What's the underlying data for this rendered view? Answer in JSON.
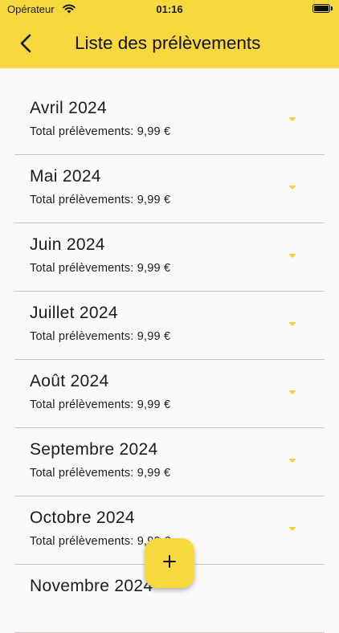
{
  "status_bar": {
    "carrier": "Opérateur",
    "time": "01:16"
  },
  "header": {
    "title": "Liste des prélèvements"
  },
  "months": [
    {
      "label": "Avril 2024",
      "total": "Total prélèvements: 9,99 €"
    },
    {
      "label": "Mai 2024",
      "total": "Total prélèvements: 9,99 €"
    },
    {
      "label": "Juin 2024",
      "total": "Total prélèvements: 9,99 €"
    },
    {
      "label": "Juillet 2024",
      "total": "Total prélèvements: 9,99 €"
    },
    {
      "label": "Août 2024",
      "total": "Total prélèvements: 9,99 €"
    },
    {
      "label": "Septembre 2024",
      "total": "Total prélèvements: 9,99 €"
    },
    {
      "label": "Octobre 2024",
      "total": "Total prélèvements: 9,99 €"
    },
    {
      "label": "Novembre 2024",
      "total": ""
    }
  ],
  "icons": {
    "back": "chevron-left-icon",
    "expand": "caret-down-icon",
    "add": "plus-icon",
    "wifi": "wifi-icon",
    "battery": "battery-icon"
  },
  "colors": {
    "accent": "#f7d93f",
    "background": "#fcf9fb",
    "divider": "#c9c6c4"
  }
}
